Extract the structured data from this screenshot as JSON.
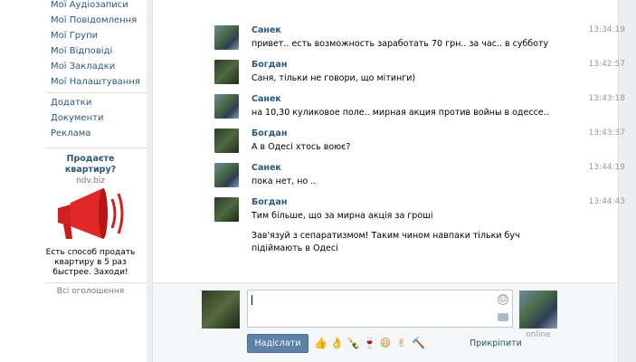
{
  "sidebar": {
    "items": [
      {
        "label": "Мої Аудіозаписи"
      },
      {
        "label": "Мої Повідомлення"
      },
      {
        "label": "Мої Групи"
      },
      {
        "label": "Мої Відповіді"
      },
      {
        "label": "Мої Закладки"
      },
      {
        "label": "Мої Налаштування"
      }
    ],
    "extra": [
      {
        "label": "Додатки"
      },
      {
        "label": "Документи"
      },
      {
        "label": "Реклама"
      }
    ],
    "ad": {
      "title": "Продаєте квартиру?",
      "domain": "ndv.biz",
      "text": "Есть способ продать квартиру в 5 раз быстрее. Заходи!",
      "all_ads": "Всі оголошення"
    }
  },
  "messages": [
    {
      "author": "Санек",
      "time": "13:34:19",
      "text": "привет.. есть возможность заработать 70 грн.. за час.. в субботу",
      "avatar": "a1"
    },
    {
      "author": "Богдан",
      "time": "13:42:57",
      "text": "Саня, тільки не говори, що мітинги)",
      "avatar": "a2"
    },
    {
      "author": "Санек",
      "time": "13:43:18",
      "text": "на 10,30 куликовое поле.. мирная акция против войны в одессе..",
      "avatar": "a1"
    },
    {
      "author": "Богдан",
      "time": "13:43:37",
      "text": "А в Одесі хтось воює?",
      "avatar": "a2"
    },
    {
      "author": "Санек",
      "time": "13:44:19",
      "text": "пока нет, но ..",
      "avatar": "a1"
    },
    {
      "author": "Богдан",
      "time": "13:44:43",
      "text": "Тим більше, що за мирна акція за гроші",
      "text2": "Зав'язуй з сепаратизмом! Таким чином навпаки тільки буч підіймають в Одесі",
      "avatar": "a2"
    }
  ],
  "composer": {
    "send_label": "Надіслати",
    "attach_label": "Прикріпити",
    "peer_status": "online",
    "emojis": [
      "👍",
      "👌",
      "🍾",
      "🍷",
      "😆",
      "✌",
      "🔨"
    ]
  }
}
